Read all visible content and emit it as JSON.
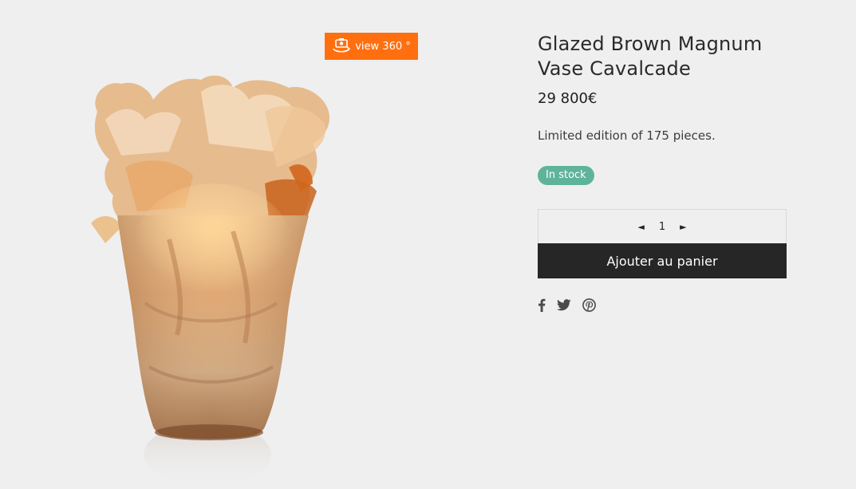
{
  "media": {
    "view360_label": "view 360 °",
    "view360_color": "#ff6f0f"
  },
  "product": {
    "title": "Glazed Brown Magnum Vase Cavalcade",
    "price": "29 800€",
    "description": "Limited edition of 175 pieces.",
    "stock_label": "In stock",
    "stock_color": "#5fb39b"
  },
  "cart": {
    "quantity": "1",
    "decrement_icon": "◄",
    "increment_icon": "►",
    "add_to_cart_label": "Ajouter au panier"
  },
  "share": {
    "icons": [
      "facebook-icon",
      "twitter-icon",
      "pinterest-icon"
    ]
  }
}
